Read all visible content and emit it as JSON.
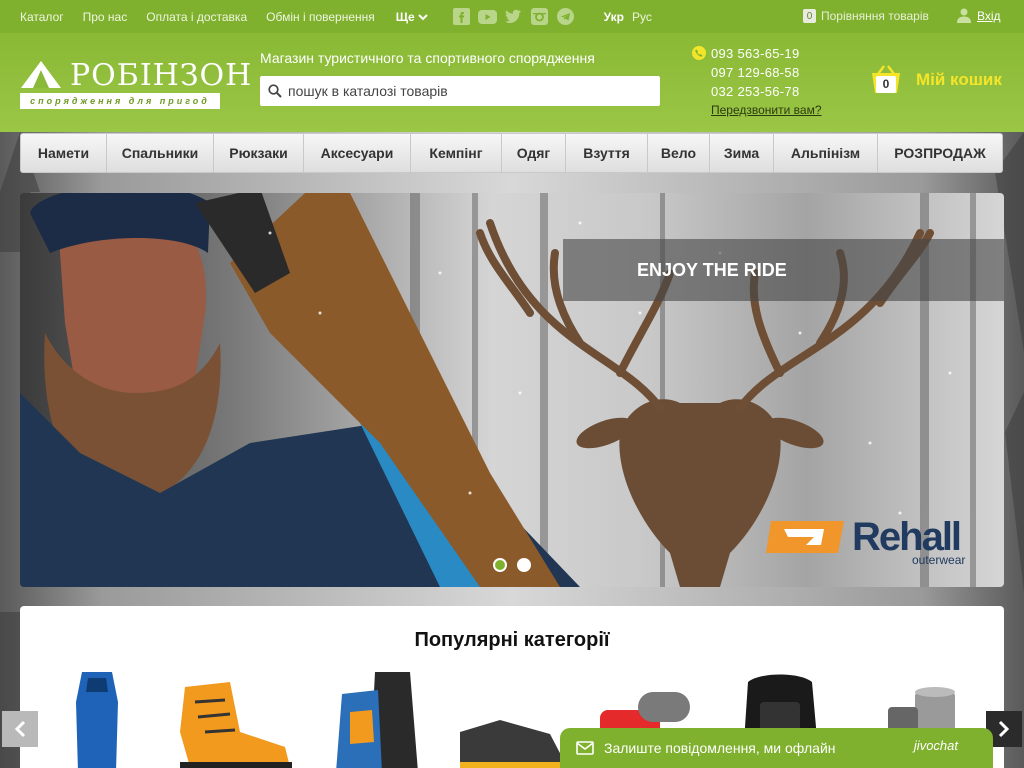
{
  "topbar": {
    "links": [
      "Каталог",
      "Про нас",
      "Оплата і доставка",
      "Обмін і повернення"
    ],
    "more_label": "Ще",
    "social_icons": [
      "facebook-icon",
      "youtube-icon",
      "twitter-icon",
      "instagram-icon",
      "telegram-icon"
    ],
    "languages": [
      "Укр",
      "Рус"
    ],
    "active_language": "Укр",
    "compare_count": "0",
    "compare_label": "Порівняння товарів",
    "login_label": "Вхід"
  },
  "header": {
    "logo_text": "РОБІНЗОН",
    "logo_tagline": "спорядження для пригод",
    "tagline": "Магазин туристичного та спортивного спорядження",
    "search_placeholder": "пошук в каталозі товарів",
    "phones": [
      "093 563-65-19",
      "097 129-68-58",
      "032 253-56-78"
    ],
    "callback_label": "Передзвонити вам?",
    "cart_count": "0",
    "cart_label": "Мій кошик"
  },
  "nav": {
    "items": [
      "Намети",
      "Спальники",
      "Рюкзаки",
      "Аксесуари",
      "Кемпінг",
      "Одяг",
      "Взуття",
      "Вело",
      "Зима",
      "Альпінізм",
      "РОЗПРОДАЖ"
    ]
  },
  "slider": {
    "caption": "ENJOY THE RIDE",
    "brand_name": "Rehall",
    "brand_sub": "outerwear",
    "slide_count": 2,
    "active_slide": 1
  },
  "popular": {
    "title": "Популярні категорії"
  },
  "chat": {
    "text": "Залиште повідомлення, ми офлайн",
    "brand": "jivochat"
  },
  "colors": {
    "brand_green": "#7fb02e",
    "cart_yellow": "#f4e52a",
    "nav_bg": "#eeeeee"
  }
}
